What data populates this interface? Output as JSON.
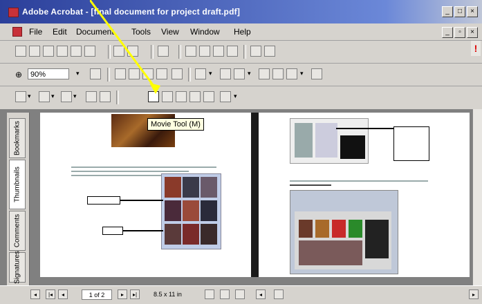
{
  "window": {
    "title": "Adobe Acrobat - [final document for project draft.pdf]",
    "controls": [
      "_",
      "□",
      "×"
    ]
  },
  "menu": {
    "items": [
      "File",
      "Edit",
      "Document",
      "Tools",
      "View",
      "Window",
      "Help"
    ]
  },
  "toolbar": {
    "zoom_value": "90%"
  },
  "tooltip": {
    "text": "Movie Tool (M)"
  },
  "nav_panel": {
    "tabs": [
      "Bookmarks",
      "Thumbnails",
      "Comments",
      "Signatures"
    ]
  },
  "status": {
    "page_indicator": "1 of 2",
    "page_size": "8.5 x 11 in"
  },
  "colors": {
    "titlebar": "#2b3f9a",
    "chrome": "#d6d3ce",
    "highlight_arrow": "#ffff00"
  }
}
